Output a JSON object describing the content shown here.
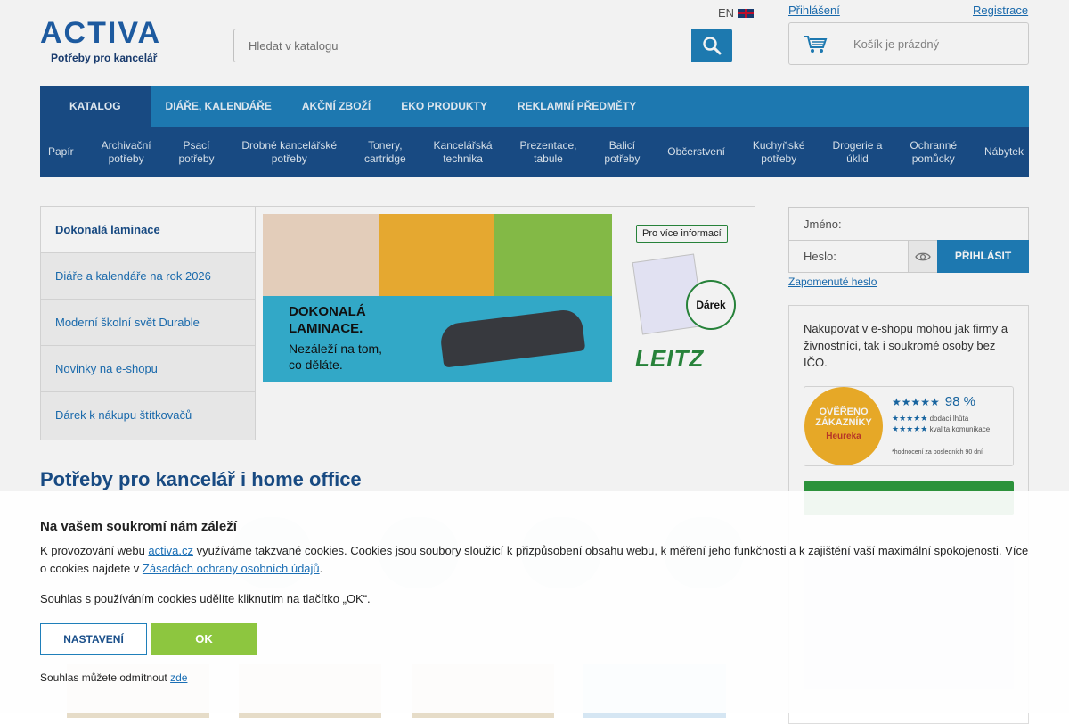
{
  "header": {
    "logo_text": "ACTIVA",
    "logo_sub": "Potřeby pro kancelář",
    "search_placeholder": "Hledat v katalogu",
    "lang": "EN",
    "login_link": "Přihlášení",
    "register_link": "Registrace",
    "cart_text": "Košík je prázdný"
  },
  "nav": {
    "top": [
      "KATALOG",
      "DIÁŘE, KALENDÁŘE",
      "AKČNÍ ZBOŽÍ",
      "EKO PRODUKTY",
      "REKLAMNÍ PŘEDMĚTY"
    ],
    "categories": [
      [
        "Papír",
        ""
      ],
      [
        "Archivační",
        "potřeby"
      ],
      [
        "Psací",
        "potřeby"
      ],
      [
        "Drobné kancelářské",
        "potřeby"
      ],
      [
        "Tonery,",
        "cartridge"
      ],
      [
        "Kancelářská",
        "technika"
      ],
      [
        "Prezentace,",
        "tabule"
      ],
      [
        "Balicí",
        "potřeby"
      ],
      [
        "Občerstvení",
        ""
      ],
      [
        "Kuchyňské",
        "potřeby"
      ],
      [
        "Drogerie a",
        "úklid"
      ],
      [
        "Ochranné",
        "pomůcky"
      ],
      [
        "Nábytek",
        ""
      ]
    ]
  },
  "sidemenu": [
    "Dokonalá laminace",
    "Diáře a kalendáře na rok 2026",
    "Moderní školní svět Durable",
    "Novinky na e-shopu",
    "Dárek k nákupu štítkovačů"
  ],
  "banner": {
    "headline_1": "DOKONALÁ",
    "headline_2": "LAMINACE.",
    "sub_1": "Nezáleží na tom,",
    "sub_2": "co děláte.",
    "info_button": "Pro více informací",
    "gift": "Dárek",
    "brand": "LEITZ"
  },
  "login": {
    "name_label": "Jméno:",
    "password_label": "Heslo:",
    "submit": "PŘIHLÁSIT",
    "forgot": "Zapomenuté heslo"
  },
  "infobox": {
    "text": "Nakupovat v e-shopu mohou jak firmy a živnostníci, tak i soukromé osoby bez IČO.",
    "badge_1": "OVĚŘENO",
    "badge_2": "ZÁKAZNÍKY",
    "badge_3": "Heureka",
    "rating": "98 %",
    "line_1": "dodací lhůta",
    "line_2": "kvalita komunikace",
    "note": "*hodnocení za posledních 90 dní"
  },
  "main": {
    "heading": "Potřeby pro kancelář i home office"
  },
  "cookie": {
    "title": "Na vašem soukromí nám záleží",
    "text_1": "K provozování webu ",
    "link_1": "activa.cz",
    "text_2": " využíváme takzvané cookies. Cookies jsou soubory sloužící k přizpůsobení obsahu webu, k měření jeho funkčnosti a k zajištění vaší maximální spokojenosti. Více o cookies najdete v ",
    "link_2": "Zásadách ochrany osobních údajů",
    "text_3": ".",
    "consent": "Souhlas s používáním cookies udělíte kliknutím na tlačítko „OK“.",
    "settings_button": "NASTAVENÍ",
    "ok_button": "OK",
    "refuse_text": "Souhlas můžete odmítnout ",
    "refuse_link": "zde"
  },
  "colors": {
    "primary_blue": "#1f7fba",
    "dark_blue": "#1a4f8a",
    "ok_green": "#8dc63f",
    "leitz_green": "#2a8a3e"
  }
}
